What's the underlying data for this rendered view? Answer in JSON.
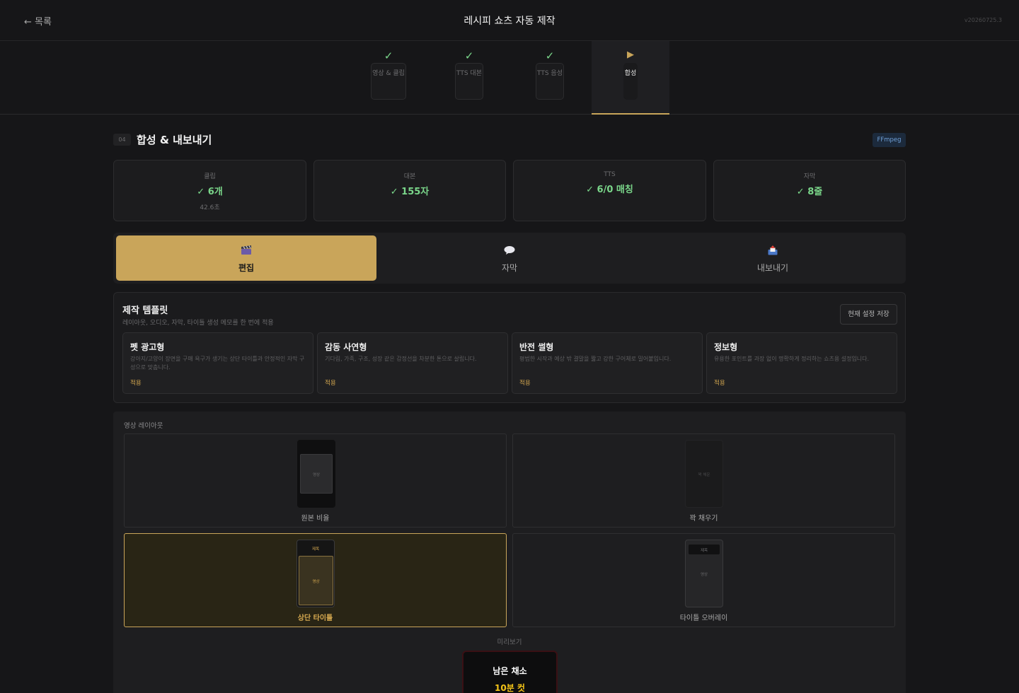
{
  "header": {
    "back_label": "← 목록",
    "title": "레시피 쇼츠 자동 제작",
    "version": "v20260725.3"
  },
  "steps": [
    {
      "mark": "✓",
      "label": "영상 & 클립",
      "status": "done"
    },
    {
      "mark": "✓",
      "label": "TTS 대본",
      "status": "done"
    },
    {
      "mark": "✓",
      "label": "TTS 음성",
      "status": "done"
    },
    {
      "mark": "▶",
      "label": "합성",
      "status": "active"
    }
  ],
  "section": {
    "number": "04",
    "title": "합성 & 내보내기",
    "engine_badge": "FFmpeg"
  },
  "stats": [
    {
      "key": "클립",
      "value": "✓ 6개",
      "sub": "42.6초"
    },
    {
      "key": "대본",
      "value": "✓ 155자",
      "sub": ""
    },
    {
      "key": "TTS",
      "value": "✓ 6/0 매칭",
      "sub": ""
    },
    {
      "key": "자막",
      "value": "✓ 8줄",
      "sub": ""
    }
  ],
  "tabs": [
    {
      "icon": "clapperboard-icon",
      "label": "편집",
      "active": true
    },
    {
      "icon": "speech-bubble-icon",
      "label": "자막",
      "active": false
    },
    {
      "icon": "outbox-tray-icon",
      "label": "내보내기",
      "active": false
    }
  ],
  "templates": {
    "title": "제작 템플릿",
    "subtitle": "레이아웃, 오디오, 자막, 타이틀 생성 메모를 한 번에 적용",
    "save_button": "현재 설정 저장",
    "items": [
      {
        "name": "펫 광고형",
        "desc": "강아지/고양이 장면을 구매 욕구가 생기는 상단 타이틀과 안정적인 자막 구성으로 맞춥니다.",
        "apply": "적용"
      },
      {
        "name": "감동 사연형",
        "desc": "기다림, 가족, 구조, 성장 같은 감정선을 차분한 톤으로 살립니다.",
        "apply": "적용"
      },
      {
        "name": "반전 썰형",
        "desc": "평범한 시작과 예상 밖 결말을 짧고 강한 구어체로 밀어붙입니다.",
        "apply": "적용"
      },
      {
        "name": "정보형",
        "desc": "유용한 포인트를 과장 없이 명확하게 정리하는 쇼츠용 설정입니다.",
        "apply": "적용"
      }
    ]
  },
  "layout": {
    "label": "영상 레이아웃",
    "options": [
      {
        "name": "원본 비율",
        "inner": "영상",
        "selected": false
      },
      {
        "name": "꽉 채우기",
        "inner": "꽉 채운",
        "selected": false
      },
      {
        "name": "상단 타이틀",
        "title_tag": "제목",
        "inner": "영상",
        "selected": true
      },
      {
        "name": "타이틀 오버레이",
        "title_tag": "제목",
        "inner": "영상",
        "selected": false
      }
    ]
  },
  "preview": {
    "label": "미리보기",
    "line1": "남은 채소",
    "line2": "10분 컷"
  },
  "colors": {
    "accent": "#c9a55a",
    "success": "#7ad68a",
    "background": "#161618",
    "badge_blue": "#6fa0d8"
  }
}
